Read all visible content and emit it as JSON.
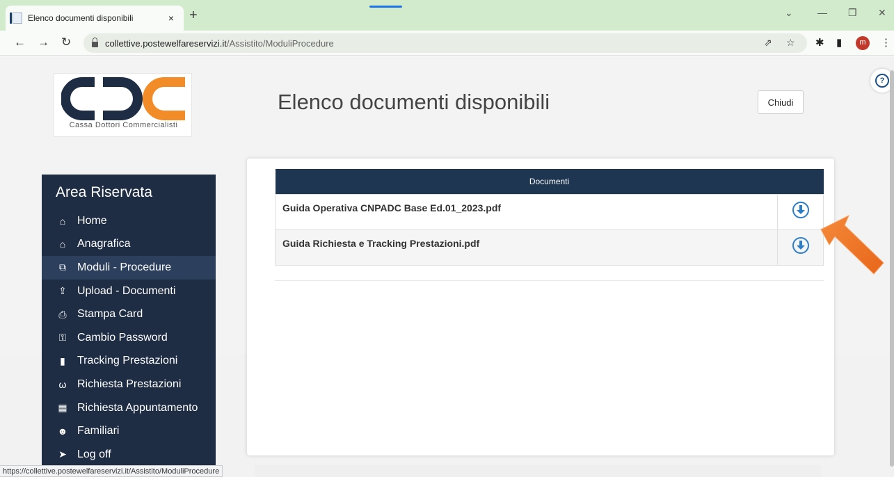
{
  "browser": {
    "tab_title": "Elenco documenti disponibili",
    "tab_close": "×",
    "new_tab": "+",
    "url_host": "collettive.postewelfareservizi.it",
    "url_path": "/Assistito/ModuliProcedure",
    "avatar_letter": "m",
    "status_url": "https://collettive.postewelfareservizi.it/Assistito/ModuliProcedure"
  },
  "logo": {
    "subtitle": "Cassa Dottori Commercialisti"
  },
  "header": {
    "title": "Elenco documenti disponibili",
    "close_label": "Chiudi"
  },
  "sidebar": {
    "title": "Area Riservata",
    "items": [
      {
        "label": "Home",
        "icon": "home-icon"
      },
      {
        "label": "Anagrafica",
        "icon": "bank-icon"
      },
      {
        "label": "Moduli - Procedure",
        "icon": "copy-icon"
      },
      {
        "label": "Upload - Documenti",
        "icon": "upload-icon"
      },
      {
        "label": "Stampa Card",
        "icon": "print-icon"
      },
      {
        "label": "Cambio Password",
        "icon": "key-icon"
      },
      {
        "label": "Tracking Prestazioni",
        "icon": "book-icon"
      },
      {
        "label": "Richiesta Prestazioni",
        "icon": "stethoscope-icon"
      },
      {
        "label": "Richiesta Appuntamento",
        "icon": "calendar-icon"
      },
      {
        "label": "Familiari",
        "icon": "users-icon"
      },
      {
        "label": "Log off",
        "icon": "logout-icon"
      }
    ],
    "active_index": 2
  },
  "documents": {
    "column_header": "Documenti",
    "rows": [
      {
        "name": "Guida Operativa CNPADC Base Ed.01_2023.pdf"
      },
      {
        "name": "Guida Richiesta e Tracking Prestazioni.pdf"
      }
    ]
  },
  "colors": {
    "sidebar_bg": "#1e2d44",
    "table_header_bg": "#1e3652",
    "download_icon": "#2a7dc9",
    "annotation_arrow": "#f07a28"
  }
}
